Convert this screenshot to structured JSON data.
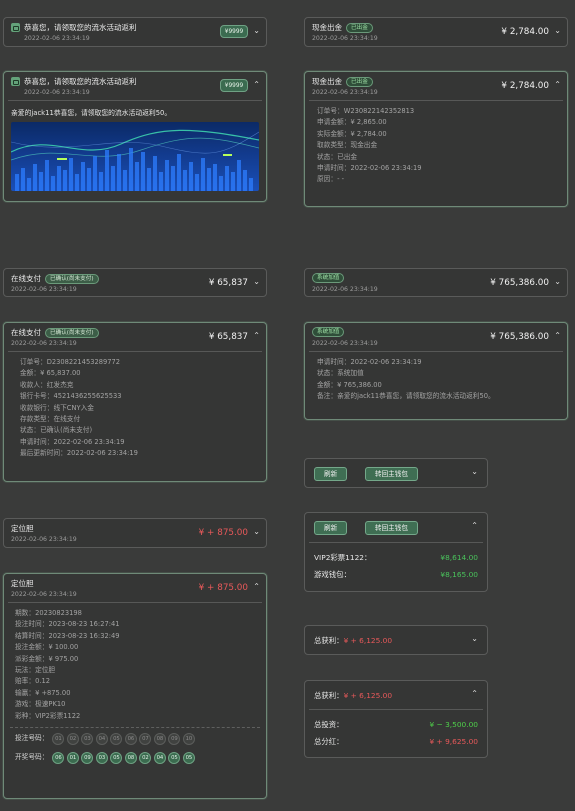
{
  "promo": {
    "title": "恭喜您，请领取您的流水活动返利",
    "date": "2022-02-06 23:34:19",
    "pill": "¥9999",
    "message": "亲爱的jack11恭喜您，请领取您的流水活动返利50。",
    "chevron_down": "⌄",
    "chevron_up": "⌃"
  },
  "withdraw": {
    "title": "现金出金",
    "badge": "已出金",
    "date": "2022-02-06 23:34:19",
    "amount": "¥ 2,784.00",
    "details": [
      {
        "label": "订单号：",
        "value": "W230822142352813"
      },
      {
        "label": "申请金额：",
        "value": "¥ 2,865.00"
      },
      {
        "label": "实际金额：",
        "value": "¥ 2,784.00"
      },
      {
        "label": "取款类型：",
        "value": "现金出金"
      },
      {
        "label": "状态：",
        "value": "已出金"
      },
      {
        "label": "申请时间：",
        "value": "2022-02-06 23:34:19"
      },
      {
        "label": "原因：",
        "value": "- -"
      }
    ]
  },
  "online_pay": {
    "title": "在线支付",
    "badge": "已确认(尚未支付)",
    "date": "2022-02-06 23:34:19",
    "amount": "¥ 65,837",
    "details": [
      {
        "label": "订单号：",
        "value": "D2308221453289772"
      },
      {
        "label": "金额：",
        "value": "¥ 65,837.00"
      },
      {
        "label": "收款人：",
        "value": "红发杰克"
      },
      {
        "label": "银行卡号：",
        "value": "4521436255625533"
      },
      {
        "label": "收款银行：",
        "value": "线下CNY入金"
      },
      {
        "label": "存款类型：",
        "value": "在线支付"
      },
      {
        "label": "状态：",
        "value": "已确认(尚未支付)"
      },
      {
        "label": "申请时间：",
        "value": "2022-02-06 23:34:19"
      },
      {
        "label": "最后更新时间：",
        "value": "2022-02-06 23:34:19"
      }
    ]
  },
  "system_add": {
    "badge": "系统加值",
    "date": "2022-02-06 23:34:19",
    "amount": "¥ 765,386.00",
    "details": [
      {
        "label": "申请时间：",
        "value": "2022-02-06 23:34:19"
      },
      {
        "label": "状态：",
        "value": "系统加值"
      },
      {
        "label": "金额：",
        "value": "¥ 765,386.00"
      },
      {
        "label": "备注：",
        "value": "亲爱的jack11恭喜您，请领取您的流水活动返利50。"
      }
    ]
  },
  "wallet": {
    "refresh": "刷新",
    "to_main": "转回主钱包",
    "items": [
      {
        "label": "VIP2彩票1122：",
        "value": "¥8,614.00"
      },
      {
        "label": "游戏钱包：",
        "value": "¥8,165.00"
      }
    ]
  },
  "locate": {
    "title": "定位胆",
    "date": "2022-02-06 23:34:19",
    "amount": "¥ + 875.00",
    "details": [
      {
        "label": "期数：",
        "value": "20230823198"
      },
      {
        "label": "投注时间：",
        "value": "2023-08-23 16:27:41"
      },
      {
        "label": "结算时间：",
        "value": "2023-08-23 16:32:49"
      },
      {
        "label": "投注金额：",
        "value": "¥ 100.00"
      },
      {
        "label": "派彩金额：",
        "value": "¥ 975.00"
      },
      {
        "label": "玩法：",
        "value": "定位胆"
      },
      {
        "label": "赔率：",
        "value": "0.12"
      },
      {
        "label": "输赢：",
        "value": "¥ +875.00"
      },
      {
        "label": "游戏：",
        "value": "极速PK10"
      },
      {
        "label": "彩种：",
        "value": "VIP2彩票1122"
      }
    ],
    "bet_label": "投注号码：",
    "bet_numbers": [
      "01",
      "02",
      "03",
      "04",
      "05",
      "06",
      "07",
      "08",
      "09",
      "10"
    ],
    "draw_label": "开奖号码：",
    "draw_numbers": [
      "06",
      "01",
      "09",
      "03",
      "05",
      "08",
      "02",
      "04",
      "05",
      "05"
    ]
  },
  "profit": {
    "label": "总获利：",
    "value": "¥ + 6,125.00",
    "invest_label": "总投资：",
    "invest_value": "¥ − 3,500.00",
    "bonus_label": "总分红：",
    "bonus_value": "¥ + 9,625.00"
  },
  "colors": {
    "accent": "#3f6e53",
    "red": "#e8595a",
    "green": "#4fcf4a",
    "bg": "#3a3b3a"
  }
}
